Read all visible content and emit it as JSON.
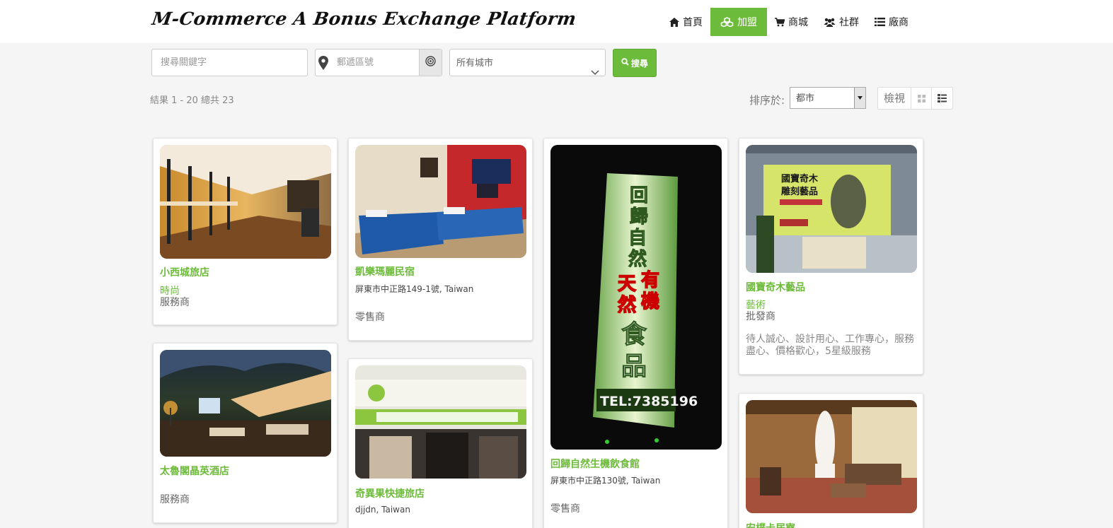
{
  "header": {
    "brand": "M-Commerce A Bonus Exchange Platform",
    "nav": [
      {
        "label": "首頁",
        "icon": "home-icon"
      },
      {
        "label": "加盟",
        "icon": "cubes-icon",
        "active": true
      },
      {
        "label": "商城",
        "icon": "cart-icon"
      },
      {
        "label": "社群",
        "icon": "users-icon"
      },
      {
        "label": "廠商",
        "icon": "list-icon"
      }
    ],
    "accent_color": "#6dbb3a"
  },
  "search": {
    "keyword_placeholder": "搜尋關鍵字",
    "zip_placeholder": "郵遞區號",
    "city_selected": "所有城市",
    "button_label": "搜尋"
  },
  "results": {
    "summary": "結果 1 - 20 總共 23",
    "sort_label": "排序於:",
    "sort_selected": "都市",
    "view_label": "檢視"
  },
  "cards": [
    {
      "title": "小西城旅店",
      "category": "時尚",
      "type": "服務商"
    },
    {
      "title": "太魯閣晶英酒店",
      "type": "服務商"
    },
    {
      "title": "凱樂瑪麗民宿",
      "address": "屏東市中正路149-1號, Taiwan",
      "type": "零售商"
    },
    {
      "title": "奇異果快捷旅店",
      "address": "djjdn, Taiwan"
    },
    {
      "title": "回歸自然生機飲食館",
      "address": "屏東市中正路130號, Taiwan",
      "type": "零售商",
      "sign_text": "回歸自然 有機 天然 食品 TEL:7385196"
    },
    {
      "title": "國寶奇木藝品",
      "category": "藝術",
      "type": "批發商",
      "description": "待人誠心、設計用心、工作專心，服務盡心、價格歡心，5星級服務",
      "sign_text": "國寶奇木 雕刻藝品"
    },
    {
      "title": "安樸卡居寮"
    }
  ]
}
